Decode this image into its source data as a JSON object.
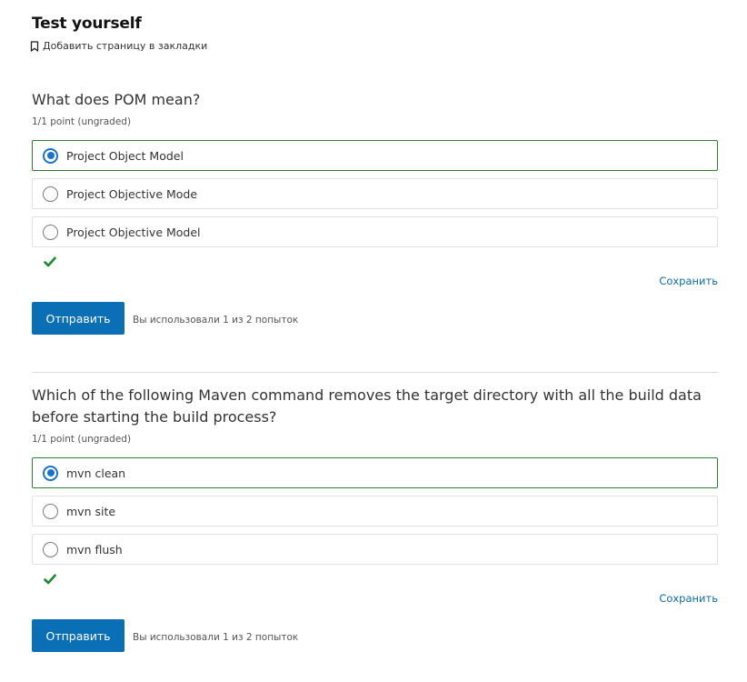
{
  "header": {
    "title": "Test yourself",
    "bookmark_label": "Добавить страницу в закладки"
  },
  "problems": [
    {
      "question": "What does POM mean?",
      "points": "1/1 point (ungraded)",
      "options": [
        {
          "label": "Project Object Model",
          "selected": true,
          "correct": true
        },
        {
          "label": "Project Objective Mode",
          "selected": false
        },
        {
          "label": "Project Objective Model",
          "selected": false
        }
      ],
      "save_label": "Сохранить",
      "submit_label": "Отправить",
      "attempts_text": "Вы использовали 1 из 2 попыток"
    },
    {
      "question": "Which of the following Maven command removes the target directory with all the build data before starting the build process?",
      "points": "1/1 point (ungraded)",
      "options": [
        {
          "label": "mvn clean",
          "selected": true,
          "correct": true
        },
        {
          "label": "mvn site",
          "selected": false
        },
        {
          "label": "mvn flush",
          "selected": false
        }
      ],
      "save_label": "Сохранить",
      "submit_label": "Отправить",
      "attempts_text": "Вы использовали 1 из 2 попыток"
    }
  ],
  "colors": {
    "accent": "#0a6fb5",
    "correct": "#2e7d32",
    "link": "#0d6ca1"
  }
}
